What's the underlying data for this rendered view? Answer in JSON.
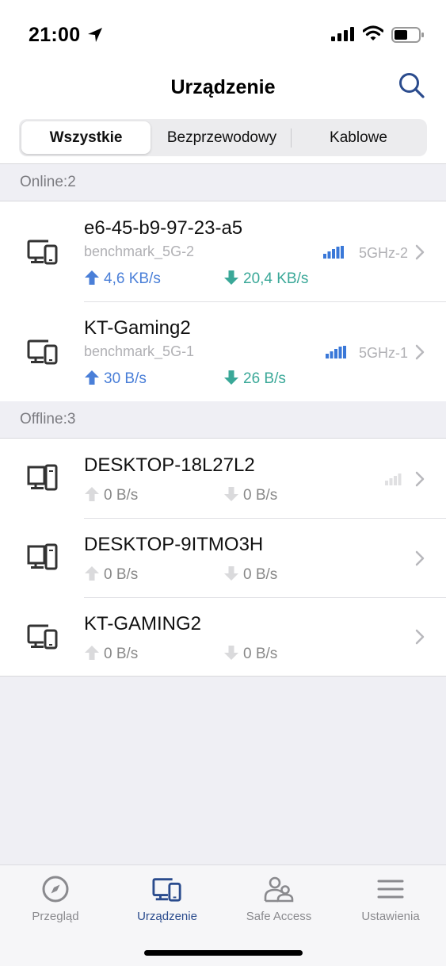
{
  "status": {
    "time": "21:00"
  },
  "nav": {
    "title": "Urządzenie"
  },
  "segments": [
    "Wszystkie",
    "Bezprzewodowy",
    "Kablowe"
  ],
  "sections": {
    "online": {
      "label": "Online:2",
      "devices": [
        {
          "name": "e6-45-b9-97-23-a5",
          "ssid": "benchmark_5G-2",
          "band": "5GHz-2",
          "up": "4,6 KB/s",
          "down": "20,4 KB/s",
          "signal": "strong"
        },
        {
          "name": "KT-Gaming2",
          "ssid": "benchmark_5G-1",
          "band": "5GHz-1",
          "up": "30 B/s",
          "down": "26 B/s",
          "signal": "strong"
        }
      ]
    },
    "offline": {
      "label": "Offline:3",
      "devices": [
        {
          "name": "DESKTOP-18L27L2",
          "up": "0 B/s",
          "down": "0 B/s",
          "signal": "none"
        },
        {
          "name": "DESKTOP-9ITMO3H",
          "up": "0 B/s",
          "down": "0 B/s"
        },
        {
          "name": "KT-GAMING2",
          "up": "0 B/s",
          "down": "0 B/s"
        }
      ]
    }
  },
  "tabs": [
    {
      "label": "Przegląd",
      "icon": "compass-icon"
    },
    {
      "label": "Urządzenie",
      "icon": "devices-icon",
      "active": true
    },
    {
      "label": "Safe Access",
      "icon": "users-icon"
    },
    {
      "label": "Ustawienia",
      "icon": "menu-icon"
    }
  ],
  "colors": {
    "accent": "#2a4b8d",
    "upload": "#4a7fd8",
    "download": "#3aa898",
    "signal": "#3a78d8"
  }
}
